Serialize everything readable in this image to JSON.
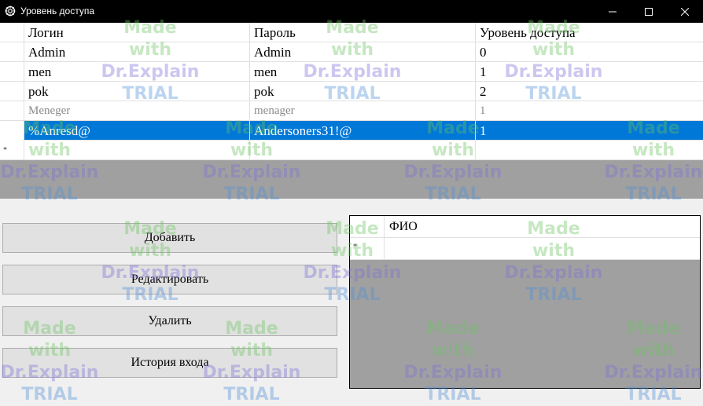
{
  "window": {
    "title": "Уровень доступа",
    "app_icon": "gear-icon",
    "controls": [
      "minimize-icon",
      "maximize-icon",
      "close-icon"
    ]
  },
  "users_grid": {
    "columns": [
      "Логин",
      "Пароль",
      "Уровень доступа"
    ],
    "rows": [
      {
        "login": "Admin",
        "password": "Admin",
        "level": "0"
      },
      {
        "login": "men",
        "password": "men",
        "level": "1"
      },
      {
        "login": "pok",
        "password": "pok",
        "level": "2"
      },
      {
        "login": "Meneger",
        "password": "menager",
        "level": "1"
      },
      {
        "login": "%Anresd@",
        "password": "Andersoners31!@",
        "level": "1"
      }
    ],
    "selected_row": 4,
    "new_row_marker": "*",
    "selection_color": "#0078d7"
  },
  "buttons": {
    "add": "Добавить",
    "edit": "Редактировать",
    "delete": "Удалить",
    "history": "История входа"
  },
  "fio_grid": {
    "column": "ФИО",
    "new_row_marker": "*"
  },
  "watermark": {
    "line1": "Made with",
    "line2": "Dr.Explain",
    "line3": "TRIAL"
  }
}
